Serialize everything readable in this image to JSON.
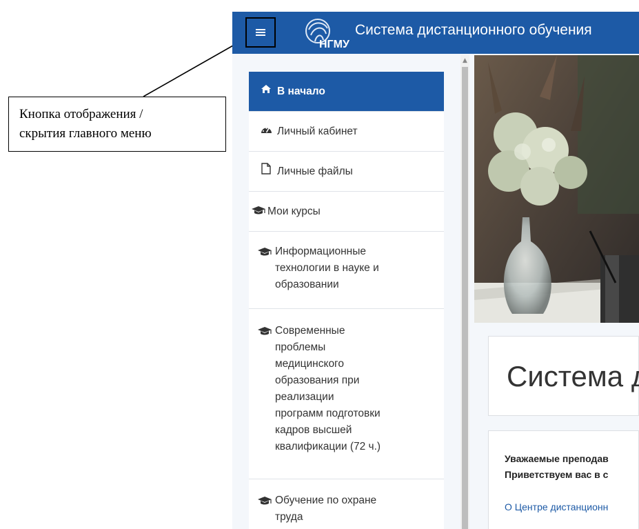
{
  "annotation": {
    "line1": "Кнопка отображения /",
    "line2": "скрытия главного меню"
  },
  "header": {
    "logo_text": "НГМУ",
    "site_title": "Система дистанционного обучения",
    "menu_button_icon": "hamburger-icon",
    "bg_color": "#1d5aa6"
  },
  "sidebar": {
    "items": [
      {
        "label": "В начало",
        "icon": "home-icon",
        "active": true
      },
      {
        "label": "Личный кабинет",
        "icon": "dashboard-icon"
      },
      {
        "label": "Личные файлы",
        "icon": "file-icon"
      },
      {
        "label": "Мои курсы",
        "icon": "graduation-cap-icon"
      },
      {
        "label_lines": [
          "Информационные",
          "технологии в науке и",
          "образовании"
        ],
        "icon": "graduation-cap-icon"
      },
      {
        "label_lines": [
          "Современные",
          "проблемы",
          "медицинского",
          "образования при",
          "реализации",
          "программ подготовки",
          "кадров высшей",
          "квалификации (72 ч.)"
        ],
        "icon": "graduation-cap-icon"
      },
      {
        "label_lines": [
          "Обучение по охране",
          "труда"
        ],
        "icon": "graduation-cap-icon"
      }
    ]
  },
  "main": {
    "title": "Система д",
    "intro_line1": "Уважаемые преподав",
    "intro_line2": "Приветствуем вас в с",
    "link": "О Центре дистанционн"
  }
}
